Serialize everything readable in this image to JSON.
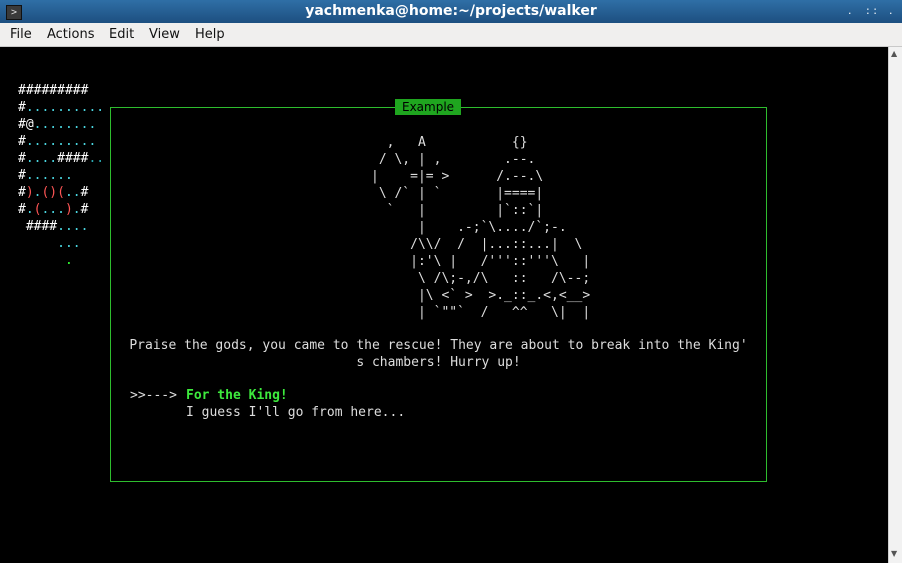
{
  "window": {
    "title": "yachmenka@home:~/projects/walker",
    "controls": [
      "minimize-button",
      "maximize-button",
      "close-button"
    ],
    "controls_glyphs": [
      ". ",
      ": :",
      "."
    ]
  },
  "menu": [
    "File",
    "Actions",
    "Edit",
    "View",
    "Help"
  ],
  "map_rows": [
    [
      {
        "t": "#########",
        "c": "wall"
      }
    ],
    [
      {
        "t": "#",
        "c": "wall"
      },
      {
        "t": "..........",
        "c": "floor"
      }
    ],
    [
      {
        "t": "#@",
        "c": "wall"
      },
      {
        "t": "........",
        "c": "floor"
      }
    ],
    [
      {
        "t": "#",
        "c": "wall"
      },
      {
        "t": ".........",
        "c": "floor"
      }
    ],
    [
      {
        "t": "#",
        "c": "wall"
      },
      {
        "t": "....",
        "c": "floor"
      },
      {
        "t": "####",
        "c": "wall"
      },
      {
        "t": "..",
        "c": "dim"
      }
    ],
    [
      {
        "t": "#",
        "c": "wall"
      },
      {
        "t": "......",
        "c": "floor"
      }
    ],
    [
      {
        "t": "#",
        "c": "wall"
      },
      {
        "t": ")",
        "c": "redc"
      },
      {
        "t": ".",
        "c": "floor"
      },
      {
        "t": "()(",
        "c": "redc"
      },
      {
        "t": "..",
        "c": "floor"
      },
      {
        "t": "#",
        "c": "wall"
      }
    ],
    [
      {
        "t": "#",
        "c": "wall"
      },
      {
        "t": ".",
        "c": "floor"
      },
      {
        "t": "(",
        "c": "redc"
      },
      {
        "t": "...",
        "c": "floor"
      },
      {
        "t": ")",
        "c": "redc"
      },
      {
        "t": ".",
        "c": "floor"
      },
      {
        "t": "#",
        "c": "wall"
      }
    ],
    [
      {
        "t": " ####",
        "c": "wall"
      },
      {
        "t": "....",
        "c": "floor"
      }
    ],
    [
      {
        "t": "     ...",
        "c": "floor"
      }
    ],
    [
      {
        "t": "      .",
        "c": "green-dot"
      }
    ]
  ],
  "dialog": {
    "title": "Example",
    "art": [
      "  ,   A           {}",
      " / \\, | ,        .--.",
      "|    =|= >      /.--.\\",
      " \\ /` | `       |====|",
      "  `   |         |`::`|",
      "      |    .-;`\\..../`;-.",
      "     /\\\\/  /  |...::...|  \\",
      "     |:'\\ |   /'''::'''\\   |",
      "      \\ /\\;-,/\\   ::   /\\--;",
      "      |\\ <` >  >._::_.<,<__>",
      "      | `\"\"`  /   ^^   \\|  |"
    ],
    "message_line1": "Praise the gods, you came to the rescue! They are about to break into the King'",
    "message_line2": "s chambers! Hurry up!",
    "selector": ">>--->",
    "options": [
      "For the King!",
      "I guess I'll go from here..."
    ]
  }
}
